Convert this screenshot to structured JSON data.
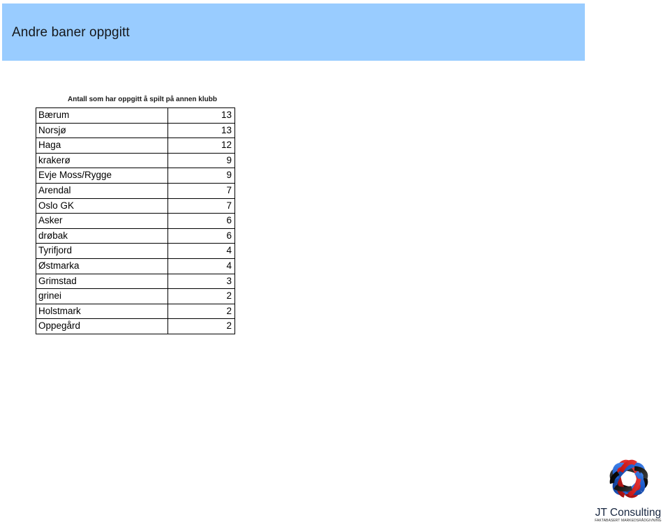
{
  "header": {
    "title": "Andre baner oppgitt",
    "banner_color": "#99CCFF"
  },
  "table": {
    "caption": "Antall  som har oppgitt å spilt på annen klubb",
    "rows": [
      {
        "club": "Bærum",
        "count": "13"
      },
      {
        "club": "Norsjø",
        "count": "13"
      },
      {
        "club": "Haga",
        "count": "12"
      },
      {
        "club": "krakerø",
        "count": "9"
      },
      {
        "club": "Evje Moss/Rygge",
        "count": "9"
      },
      {
        "club": "Arendal",
        "count": "7"
      },
      {
        "club": "Oslo GK",
        "count": "7"
      },
      {
        "club": "Asker",
        "count": "6"
      },
      {
        "club": "drøbak",
        "count": "6"
      },
      {
        "club": "Tyrifjord",
        "count": "4"
      },
      {
        "club": "Østmarka",
        "count": "4"
      },
      {
        "club": "Grimstad",
        "count": "3"
      },
      {
        "club": "grinei",
        "count": "2"
      },
      {
        "club": "Holstmark",
        "count": "2"
      },
      {
        "club": "Oppegård",
        "count": "2"
      }
    ]
  },
  "logo": {
    "name_part1": "JT ",
    "name_part2": "Consulting",
    "tagline": "FAKTABASERT MARKEDSRÅDGIVNING",
    "colors": {
      "blue": "#1f5fd0",
      "red": "#cc1b1b",
      "black": "#141414",
      "text": "#16253f"
    }
  }
}
